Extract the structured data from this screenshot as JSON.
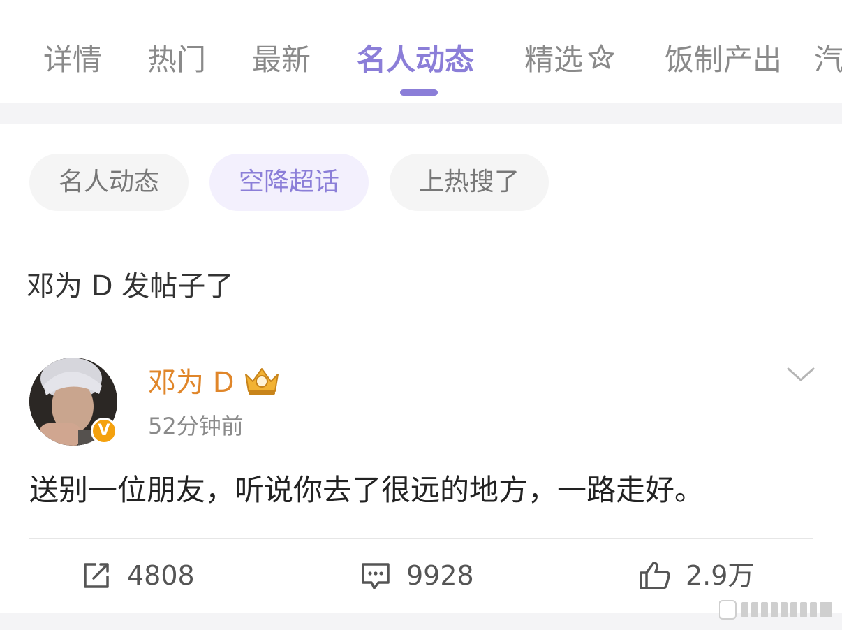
{
  "tabs": [
    {
      "label": "详情",
      "active": false
    },
    {
      "label": "热门",
      "active": false
    },
    {
      "label": "最新",
      "active": false
    },
    {
      "label": "名人动态",
      "active": true
    },
    {
      "label": "精选",
      "active": false,
      "icon": "star-sparkle-icon"
    },
    {
      "label": "饭制产出",
      "active": false
    },
    {
      "label": "汽",
      "active": false
    }
  ],
  "chips": [
    {
      "label": "名人动态",
      "active": false
    },
    {
      "label": "空降超话",
      "active": true
    },
    {
      "label": "上热搜了",
      "active": false
    }
  ],
  "section_title": "邓为 D 发帖子了",
  "post": {
    "author": "邓为 D",
    "verified_badge": "V",
    "time": "52分钟前",
    "text": "送别一位朋友，听说你去了很远的地方，一路走好。",
    "actions": {
      "repost": "4808",
      "comment": "9928",
      "like": "2.9万"
    }
  },
  "colors": {
    "accent": "#8b7ed8",
    "username": "#e0862a",
    "badge": "#f4a10e"
  }
}
